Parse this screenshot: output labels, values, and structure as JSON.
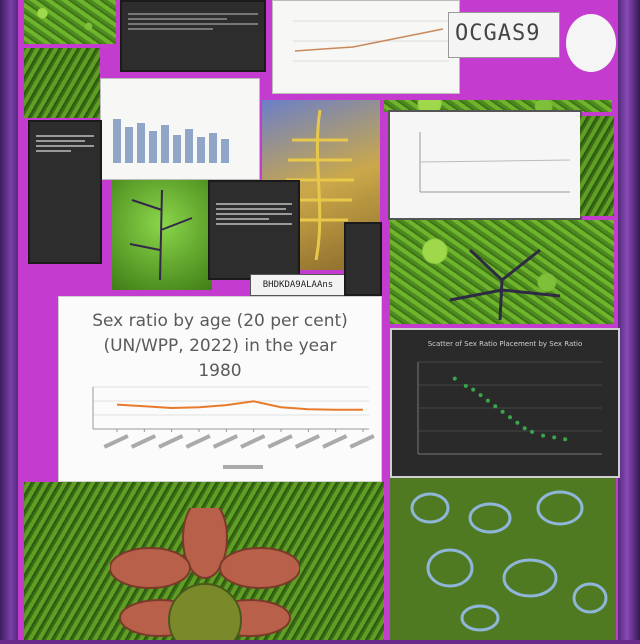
{
  "collage": {
    "label_text": "OCGAS9",
    "tag_text": "BHDKDA9ALAAns"
  },
  "main_chart": {
    "title": "Sex ratio by age (20 per cent)\n(UN/WPP, 2022) in the year\n1980",
    "ylabel": "",
    "chart_data": {
      "type": "line",
      "series": [
        {
          "values": [
            0.58,
            0.54,
            0.5,
            0.52,
            0.57,
            0.66,
            0.52,
            0.47,
            0.46,
            0.46
          ]
        }
      ],
      "ylim": [
        0,
        1
      ],
      "grid": true,
      "color": "#e87a2c"
    }
  },
  "scatter_chart": {
    "title": "Scatter of Sex Ratio Placement by Sex Ratio",
    "chart_data": {
      "type": "scatter",
      "points": [
        [
          0.2,
          0.82
        ],
        [
          0.26,
          0.74
        ],
        [
          0.3,
          0.7
        ],
        [
          0.34,
          0.64
        ],
        [
          0.38,
          0.58
        ],
        [
          0.42,
          0.52
        ],
        [
          0.46,
          0.46
        ],
        [
          0.5,
          0.4
        ],
        [
          0.54,
          0.34
        ],
        [
          0.58,
          0.28
        ],
        [
          0.62,
          0.24
        ],
        [
          0.68,
          0.2
        ],
        [
          0.74,
          0.18
        ],
        [
          0.8,
          0.16
        ]
      ],
      "xlim": [
        0,
        1
      ],
      "ylim": [
        0,
        1
      ],
      "color": "#3aa64a"
    }
  },
  "colors": {
    "frame": "#c43bd0",
    "moss": "#5f9f25"
  }
}
